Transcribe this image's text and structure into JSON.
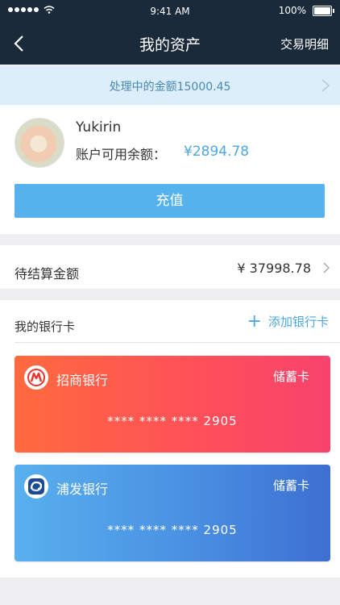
{
  "status_bar": {
    "time": "9:41 AM",
    "battery": "100%"
  },
  "nav": {
    "title": "我的资产",
    "right_link": "交易明细"
  },
  "notice": {
    "text": "处理中的金额15000.45"
  },
  "account": {
    "username": "Yukirin",
    "balance_label": "账户可用余额：",
    "balance_value": "¥2894.78",
    "charge_button": "充值"
  },
  "pending": {
    "label": "待结算金额",
    "amount": "¥ 37998.78"
  },
  "bank_cards": {
    "header": "我的银行卡",
    "add_label": "添加银行卡",
    "cards": [
      {
        "bank": "招商银行",
        "type": "储蓄卡",
        "number": "****   ****   ****   2905"
      },
      {
        "bank": "浦发银行",
        "type": "储蓄卡",
        "number": "****   ****   ****   2905"
      }
    ]
  },
  "colors": {
    "nav_bg": "#1b2a3a",
    "accent": "#4fa7de",
    "button": "#55b2ec"
  }
}
